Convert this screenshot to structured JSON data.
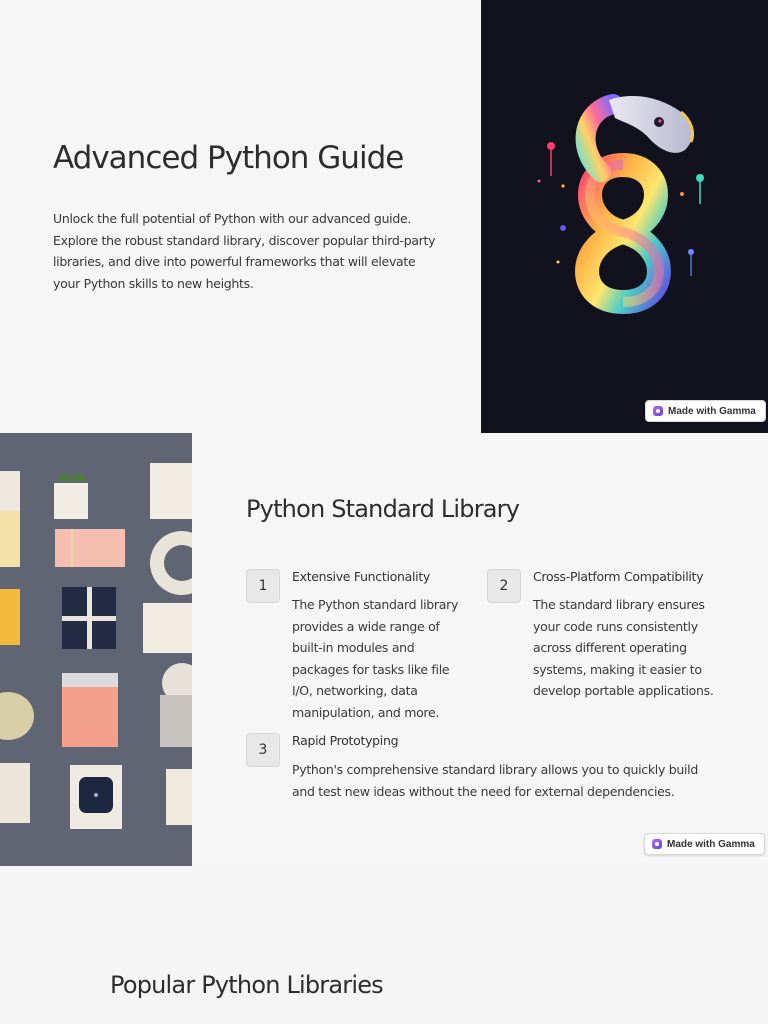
{
  "slide1": {
    "title": "Advanced Python Guide",
    "body": "Unlock the full potential of Python with our advanced guide. Explore the robust standard library, discover popular third-party libraries, and dive into powerful frameworks that will elevate your Python skills to new heights.",
    "image_icon": "infinity-snake-illustration",
    "badge_label": "Made with Gamma"
  },
  "slide2": {
    "title": "Python Standard Library",
    "image_icon": "flat-lay-objects-photo",
    "items": [
      {
        "number": "1",
        "title": "Extensive Functionality",
        "body": "The Python standard library provides a wide range of built-in modules and packages for tasks like file I/O, networking, data manipulation, and more."
      },
      {
        "number": "2",
        "title": "Cross-Platform Compatibility",
        "body": "The standard library ensures your code runs consistently across different operating systems, making it easier to develop portable applications."
      },
      {
        "number": "3",
        "title": "Rapid Prototyping",
        "body": "Python's comprehensive standard library allows you to quickly build and test new ideas without the need for external dependencies."
      }
    ],
    "badge_label": "Made with Gamma"
  },
  "slide3": {
    "title": "Popular Python Libraries"
  },
  "colors": {
    "page_bg": "#f6f6f6",
    "art_bg": "#12121e",
    "photo_bg": "#5f6572",
    "text": "#2d2d2d",
    "gamma_accent": "#9b59e6"
  }
}
